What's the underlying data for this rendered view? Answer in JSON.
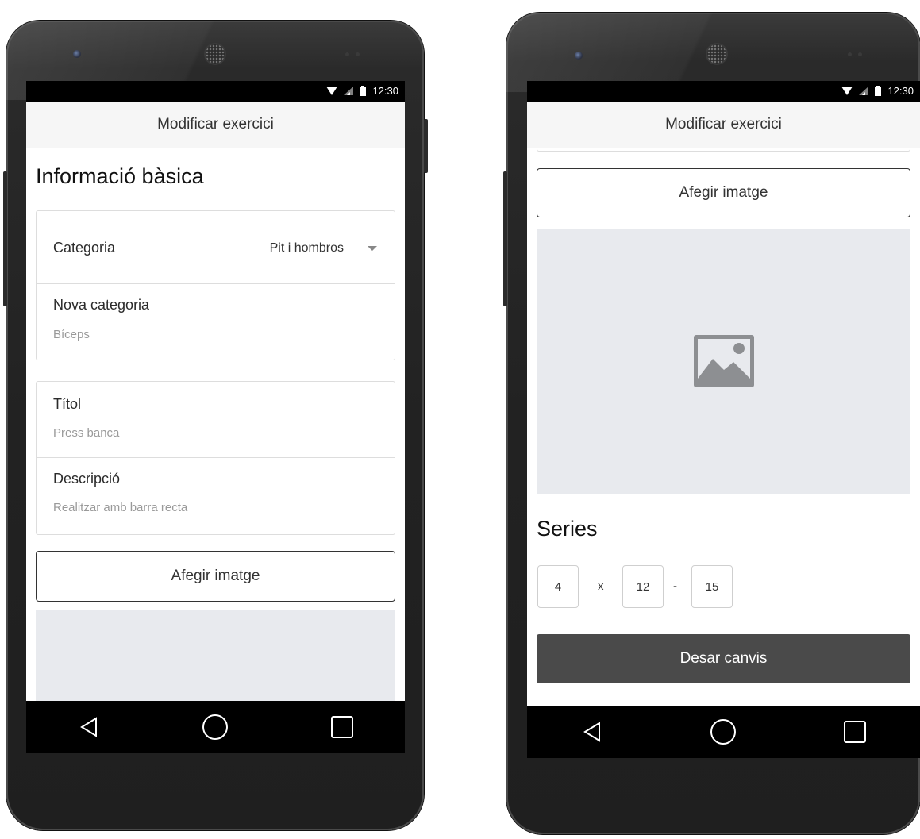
{
  "status_bar": {
    "time": "12:30"
  },
  "app_bar": {
    "title": "Modificar exercici"
  },
  "screen_left": {
    "section_title": "Informació bàsica",
    "category_card": {
      "category_label": "Categoria",
      "category_selected": "Pit i hombros",
      "new_category_label": "Nova categoria",
      "new_category_placeholder": "Bíceps"
    },
    "details_card": {
      "title_label": "Títol",
      "title_placeholder": "Press banca",
      "description_label": "Descripció",
      "description_placeholder": "Realitzar amb barra recta"
    },
    "add_image_label": "Afegir imatge"
  },
  "screen_right": {
    "add_image_label": "Afegir imatge",
    "image_placeholder_icon": "image-icon",
    "series_title": "Series",
    "series": {
      "sets": "4",
      "times_sep": "x",
      "reps_min": "12",
      "range_sep": "-",
      "reps_max": "15"
    },
    "save_label": "Desar canvis"
  },
  "nav_icons": [
    "back-icon",
    "home-icon",
    "recents-icon"
  ],
  "colors": {
    "screen_bg": "#ffffff",
    "appbar_bg": "#f6f6f6",
    "image_placeholder_bg": "#e8eaee",
    "primary_button": "#4a4a4a"
  }
}
